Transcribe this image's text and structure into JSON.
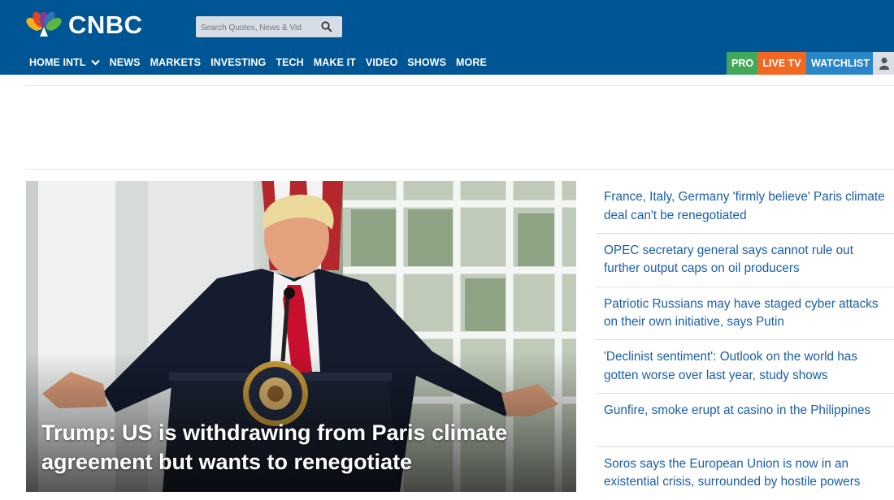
{
  "brand": {
    "name": "CNBC",
    "color": "#005594"
  },
  "search": {
    "placeholder": "Search Quotes, News & Vid"
  },
  "nav": {
    "items": [
      "HOME INTL",
      "NEWS",
      "MARKETS",
      "INVESTING",
      "TECH",
      "MAKE IT",
      "VIDEO",
      "SHOWS",
      "MORE"
    ]
  },
  "right_nav": {
    "pro": "PRO",
    "live": "LIVE TV",
    "watchlist": "WATCHLIST"
  },
  "hero": {
    "title": "Trump: US is withdrawing from Paris climate agreement but wants to renegotiate"
  },
  "headlines": [
    "France, Italy, Germany 'firmly believe' Paris climate deal can't be renegotiated",
    "OPEC secretary general says cannot rule out further output caps on oil producers",
    "Patriotic Russians may have staged cyber attacks on their own initiative, says Putin",
    "'Declinist sentiment': Outlook on the world has gotten worse over last year, study shows",
    "Gunfire, smoke erupt at casino in the Philippines",
    "Soros says the European Union is now in an existential crisis, surrounded by hostile powers"
  ],
  "colors": {
    "pro": "#43a85a",
    "live": "#f26722",
    "watchlist": "#2a86c8",
    "link": "#1a5ea8"
  },
  "icons": [
    "peacock-logo-icon",
    "search-icon",
    "chevron-down-icon",
    "user-icon"
  ]
}
